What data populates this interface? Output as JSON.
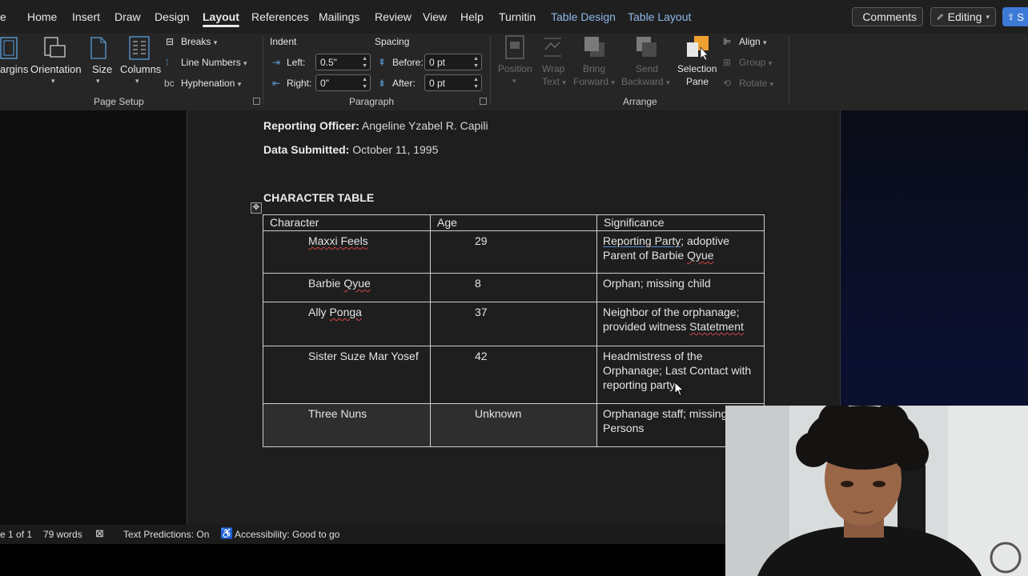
{
  "tabs": [
    {
      "label": "e"
    },
    {
      "label": "Home"
    },
    {
      "label": "Insert"
    },
    {
      "label": "Draw"
    },
    {
      "label": "Design"
    },
    {
      "label": "Layout"
    },
    {
      "label": "References"
    },
    {
      "label": "Mailings"
    },
    {
      "label": "Review"
    },
    {
      "label": "View"
    },
    {
      "label": "Help"
    },
    {
      "label": "Turnitin"
    },
    {
      "label": "Table Design"
    },
    {
      "label": "Table Layout"
    }
  ],
  "header": {
    "comments": "Comments",
    "editing": "Editing",
    "share": "S"
  },
  "ribbon": {
    "page_setup": {
      "margins": "argins",
      "orientation": "Orientation",
      "size": "Size",
      "columns": "Columns",
      "breaks": "Breaks",
      "line_numbers": "Line Numbers",
      "hyphenation": "Hyphenation",
      "label": "Page Setup"
    },
    "paragraph": {
      "indent_header": "Indent",
      "spacing_header": "Spacing",
      "left_label": "Left:",
      "left_value": "0.5\"",
      "right_label": "Right:",
      "right_value": "0\"",
      "before_label": "Before:",
      "before_value": "0 pt",
      "after_label": "After:",
      "after_value": "0 pt",
      "label": "Paragraph"
    },
    "arrange": {
      "position": [
        "Position"
      ],
      "wrap": [
        "Wrap",
        "Text"
      ],
      "bring": [
        "Bring",
        "Forward"
      ],
      "send": [
        "Send",
        "Backward"
      ],
      "selection_pane": [
        "Selection",
        "Pane"
      ],
      "align": "Align",
      "group": "Group",
      "rotate": "Rotate",
      "label": "Arrange"
    }
  },
  "document": {
    "officer_label": "Reporting Officer:",
    "officer_value": "Angeline Yzabel R. Capili",
    "submitted_label": "Data Submitted:",
    "submitted_value": "October 11, 1995",
    "table_title": "CHARACTER TABLE",
    "table": {
      "headers": [
        "Character",
        "Age",
        "Significance"
      ],
      "rows": [
        {
          "name": "Maxxi Feels",
          "age": "29",
          "sig_a": "Reporting Party",
          "sig_b": "; adoptive Parent of Barbie ",
          "sig_c": "Qyue"
        },
        {
          "name": "Barbie ",
          "name_b": "Qyue",
          "age": "8",
          "sig": "Orphan; missing child"
        },
        {
          "name": "Ally ",
          "name_b": "Ponga",
          "age": "37",
          "sig_a": "Neighbor of the orphanage; provided witness ",
          "sig_b": "Statetment"
        },
        {
          "name": "Sister Suze Mar Yosef",
          "age": "42",
          "sig": "Headmistress of the Orphanage; Last Contact with reporting party"
        },
        {
          "name": "Three Nuns",
          "age": "Unknown",
          "sig": "Orphanage staff; missing Persons"
        }
      ]
    }
  },
  "status": {
    "page": "e 1 of 1",
    "words": "79 words",
    "text_predictions": "Text Predictions: On",
    "accessibility": "Accessibility: Good to go"
  }
}
